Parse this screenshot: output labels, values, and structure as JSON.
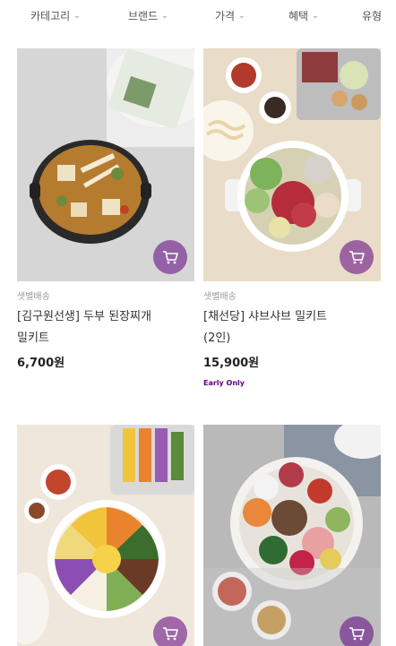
{
  "filters": [
    {
      "label": "카테고리"
    },
    {
      "label": "브랜드"
    },
    {
      "label": "가격"
    },
    {
      "label": "혜택"
    },
    {
      "label": "유형"
    }
  ],
  "products": [
    {
      "delivery": "샛별배송",
      "name_line1": "[김구원선생] 두부 된장찌개",
      "name_line2": "밀키트",
      "price": "6,700원",
      "badge": ""
    },
    {
      "delivery": "샛별배송",
      "name_line1": "[채선당] 샤브샤브 밀키트",
      "name_line2": "(2인)",
      "price": "15,900원",
      "badge": "Early Only"
    },
    {
      "delivery": "",
      "name_line1": "",
      "name_line2": "",
      "price": "",
      "badge": ""
    },
    {
      "delivery": "",
      "name_line1": "",
      "name_line2": "",
      "price": "",
      "badge": ""
    }
  ],
  "colors": {
    "accent": "#5f0080"
  },
  "icons": {
    "cart": "cart-icon",
    "chevron": "chevron-down-icon"
  }
}
